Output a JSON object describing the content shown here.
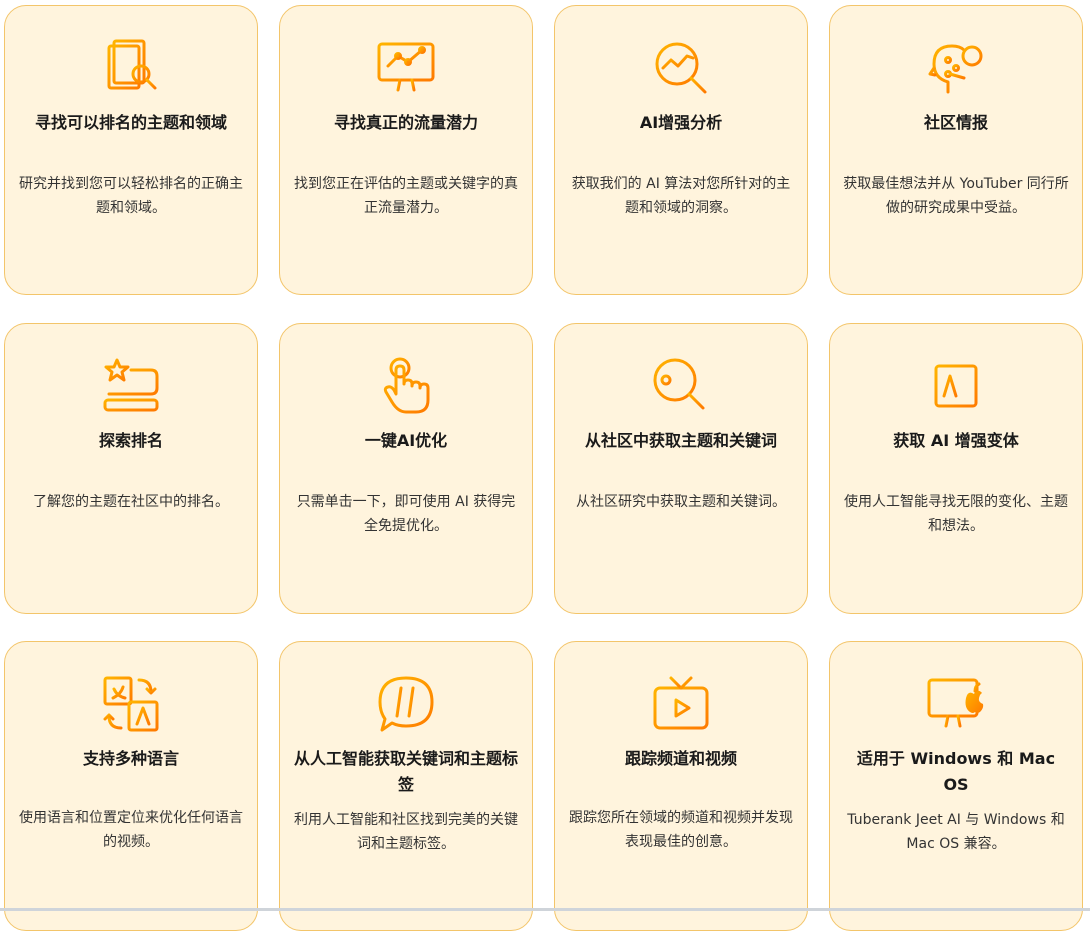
{
  "colors": {
    "accent": "#f7a600",
    "accent_dark": "#ff8a00",
    "card_bg": "#fff4dd",
    "card_border": "#f3c56a"
  },
  "cards": [
    {
      "icon": "document-search-icon",
      "title": "寻找可以排名的主题和领域",
      "desc": "研究并找到您可以轻松排名的正确主题和领域。"
    },
    {
      "icon": "monitor-chart-icon",
      "title": "寻找真正的流量潜力",
      "desc": "找到您正在评估的主题或关键字的真正流量潜力。"
    },
    {
      "icon": "analytics-magnifier-icon",
      "title": "AI增强分析",
      "desc": "获取我们的 AI 算法对您所针对的主题和领域的洞察。"
    },
    {
      "icon": "head-lightbulb-icon",
      "title": "社区情报",
      "desc": "获取最佳想法并从 YouTuber 同行所做的研究成果中受益。"
    },
    {
      "icon": "star-ranking-icon",
      "title": "探索排名",
      "desc": "了解您的主题在社区中的排名。"
    },
    {
      "icon": "tap-hand-icon",
      "title": "一键AI优化",
      "desc": "只需单击一下，即可使用 AI 获得完全免提优化。"
    },
    {
      "icon": "key-search-icon",
      "title": "从社区中获取主题和关键词",
      "desc": "从社区研究中获取主题和关键词。"
    },
    {
      "icon": "ai-chip-icon",
      "title": "获取 AI 增强变体",
      "desc": "使用人工智能寻找无限的变化、主题和想法。"
    },
    {
      "icon": "translate-icon",
      "title": "支持多种语言",
      "desc": "使用语言和位置定位来优化任何语言的视频。"
    },
    {
      "icon": "hashtag-bubble-icon",
      "title": "从人工智能获取关键词和主题标签",
      "desc": "利用人工智能和社区找到完美的关键词和主题标签。"
    },
    {
      "icon": "tv-play-icon",
      "title": "跟踪频道和视频",
      "desc": "跟踪您所在领域的频道和视频并发现表现最佳的创意。"
    },
    {
      "icon": "monitor-apple-icon",
      "title": "适用于 Windows 和 Mac OS",
      "desc": "Tuberank Jeet AI 与 Windows 和 Mac OS 兼容。"
    }
  ]
}
